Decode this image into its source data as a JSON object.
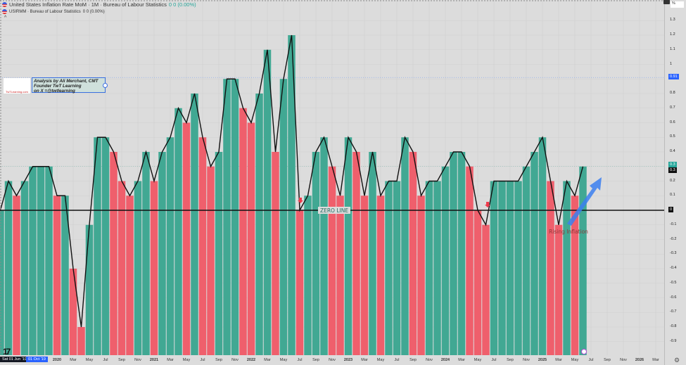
{
  "header": {
    "title": "United States Inflation Rate MoM · 1M · Bureau of Labour Statistics",
    "title_change": "0 0 (0.00%)",
    "subtitle": "USIRMM · Bureau of Labour Statistics",
    "subtitle_change": "0 0 (0.00%)",
    "collapse": "^"
  },
  "note": {
    "logo_text": "TwTLearning.com",
    "lines": [
      "Analysis by Ali Merchant, CMT",
      "Founder TwT Learning",
      "on X =@twtlearning"
    ]
  },
  "annotations": {
    "zero_line": "ZERO LINE",
    "rising": "Rising Inflation"
  },
  "axis": {
    "unit": "%",
    "price_labels": {
      "blue": "0.91",
      "green": "0.3",
      "black": "0.3",
      "zero": "0"
    },
    "cursor_date": "Sat 01 Jun '19",
    "cursor_date2": "01 Oct '19",
    "x_labels": [
      "2020",
      "Mar",
      "May",
      "Jul",
      "Sep",
      "Nov",
      "2021",
      "Mar",
      "May",
      "Jul",
      "Sep",
      "Nov",
      "2022",
      "Mar",
      "May",
      "Jul",
      "Sep",
      "Nov",
      "2023",
      "Mar",
      "May",
      "Jul",
      "Sep",
      "Nov",
      "2024",
      "Mar",
      "May",
      "Jul",
      "Sep",
      "Nov",
      "2025",
      "Mar",
      "May",
      "Jul",
      "Sep",
      "Nov",
      "2026",
      "Mar"
    ]
  },
  "colors": {
    "up": "#41a893",
    "down": "#ef5f6c",
    "line": "#111111",
    "accent": "#2962ff"
  },
  "chart_data": {
    "type": "bar",
    "title": "United States Inflation Rate MoM",
    "start": "Jun 2019",
    "end": "Jun 2025",
    "frequency": "monthly",
    "values": [
      0.0,
      0.2,
      0.1,
      0.2,
      0.3,
      0.3,
      0.3,
      0.1,
      0.1,
      -0.4,
      -0.8,
      -0.1,
      0.5,
      0.5,
      0.4,
      0.2,
      0.1,
      0.2,
      0.4,
      0.2,
      0.4,
      0.5,
      0.7,
      0.6,
      0.8,
      0.5,
      0.3,
      0.4,
      0.9,
      0.9,
      0.7,
      0.6,
      0.8,
      1.1,
      0.4,
      0.9,
      1.2,
      0.0,
      0.1,
      0.4,
      0.5,
      0.3,
      0.1,
      0.5,
      0.4,
      0.1,
      0.4,
      0.1,
      0.2,
      0.2,
      0.5,
      0.4,
      0.1,
      0.2,
      0.2,
      0.3,
      0.4,
      0.4,
      0.3,
      0.0,
      -0.1,
      0.2,
      0.2,
      0.2,
      0.2,
      0.3,
      0.4,
      0.5,
      0.2,
      -0.1,
      0.2,
      0.1,
      0.3
    ],
    "y_ticks": [
      "1.3",
      "1.2",
      "1.1",
      "1",
      "0.9",
      "0.8",
      "0.7",
      "0.6",
      "0.5",
      "0.4",
      "0.3",
      "0.2",
      "0.1",
      "0",
      "-0.1",
      "-0.2",
      "-0.3",
      "-0.4",
      "-0.5",
      "-0.6",
      "-0.7",
      "-0.8",
      "-0.9"
    ],
    "ylim": [
      -0.9,
      1.3
    ],
    "ylabel": "%",
    "grid": true
  }
}
